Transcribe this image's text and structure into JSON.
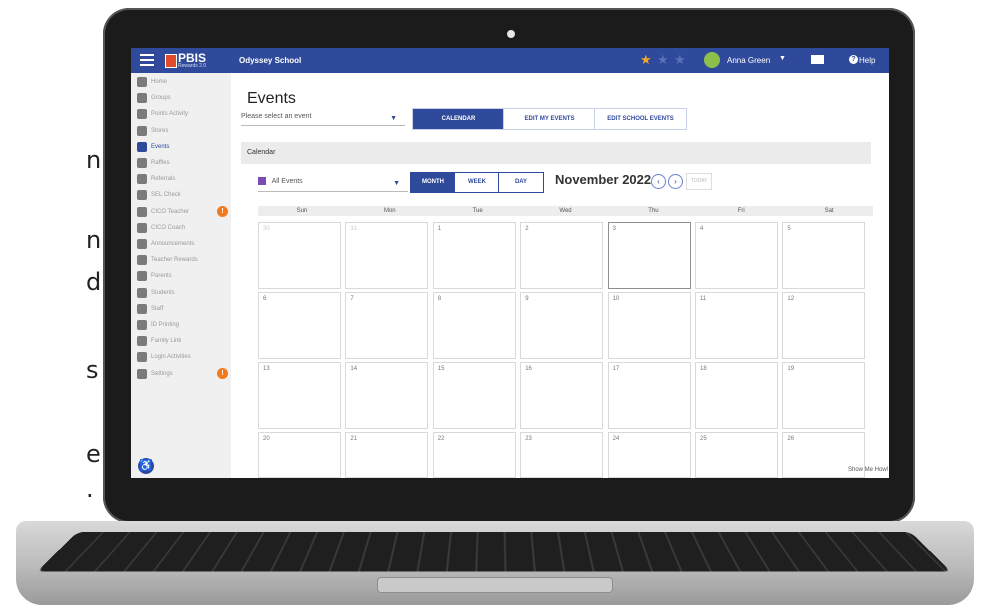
{
  "side_letters": [
    "n",
    "n",
    "d",
    "s",
    "e",
    "."
  ],
  "app": {
    "logo": "PBIS",
    "logo_sub": "Rewards 2.0",
    "school": "Odyssey School",
    "user": "Anna Green",
    "help": "Help",
    "stars_total": 3,
    "stars_active": 1
  },
  "sidebar": [
    {
      "label": "Home",
      "icon": "home-icon"
    },
    {
      "label": "Groups",
      "icon": "groups-icon"
    },
    {
      "label": "Points Activity",
      "icon": "points-icon"
    },
    {
      "label": "Stores",
      "icon": "cart-icon"
    },
    {
      "label": "Events",
      "icon": "calendar-icon",
      "active": true
    },
    {
      "label": "Raffles",
      "icon": "ticket-icon"
    },
    {
      "label": "Referrals",
      "icon": "referral-icon"
    },
    {
      "label": "SEL Check",
      "icon": "heart-icon"
    },
    {
      "label": "CICO Teacher",
      "icon": "check-icon",
      "badge": "!"
    },
    {
      "label": "CICO Coach",
      "icon": "clipboard-icon"
    },
    {
      "label": "Announcements",
      "icon": "mail-icon"
    },
    {
      "label": "Teacher Rewards",
      "icon": "star-icon"
    },
    {
      "label": "Parents",
      "icon": "parents-icon"
    },
    {
      "label": "Students",
      "icon": "students-icon"
    },
    {
      "label": "Staff",
      "icon": "staff-icon"
    },
    {
      "label": "ID Printing",
      "icon": "printer-icon"
    },
    {
      "label": "Family Link",
      "icon": "family-icon"
    },
    {
      "label": "Login Activities",
      "icon": "login-icon"
    },
    {
      "label": "Settings",
      "icon": "gear-icon",
      "badge": "!"
    }
  ],
  "main": {
    "title": "Events",
    "event_select_placeholder": "Please select an event",
    "tabs": [
      "CALENDAR",
      "EDIT MY EVENTS",
      "EDIT SCHOOL EVENTS"
    ],
    "section_label": "Calendar",
    "filter_value": "All Events",
    "views": [
      "MONTH",
      "WEEK",
      "DAY"
    ],
    "month_label": "November 2022",
    "today_label": "TODAY",
    "day_names": [
      "Sun",
      "Mon",
      "Tue",
      "Wed",
      "Thu",
      "Fri",
      "Sat"
    ],
    "weeks": [
      [
        "30",
        "31",
        "1",
        "2",
        "3",
        "4",
        "5"
      ],
      [
        "6",
        "7",
        "8",
        "9",
        "10",
        "11",
        "12"
      ],
      [
        "13",
        "14",
        "15",
        "16",
        "17",
        "18",
        "19"
      ],
      [
        "20",
        "21",
        "22",
        "23",
        "24",
        "25",
        "26"
      ]
    ],
    "show_me_how": "Show Me How!"
  },
  "colors": {
    "brand": "#2f4a9b",
    "accent": "#f07a1c"
  }
}
